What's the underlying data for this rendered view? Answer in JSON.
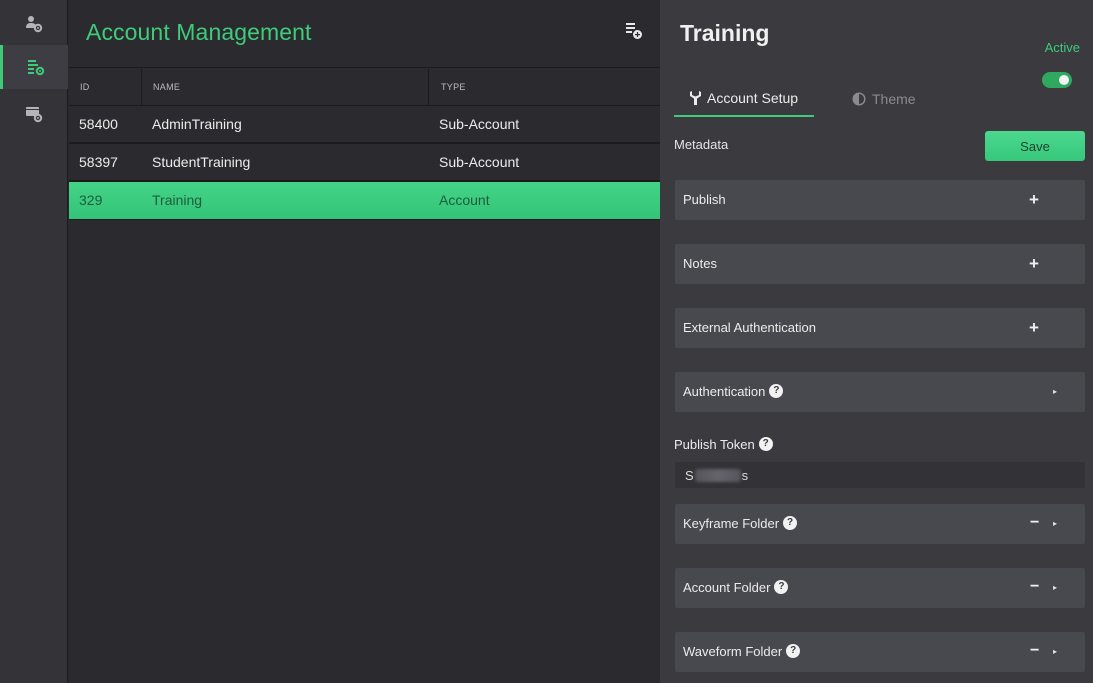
{
  "rail": {
    "items": [
      {
        "icon": "users-gear-icon",
        "active": false
      },
      {
        "icon": "list-gear-icon",
        "active": true
      },
      {
        "icon": "server-gear-icon",
        "active": false
      }
    ]
  },
  "list": {
    "title": "Account Management",
    "add_icon": "add-list-icon",
    "columns": [
      "ID",
      "NAME",
      "TYPE"
    ],
    "rows": [
      {
        "id": "58400",
        "name": "AdminTraining",
        "type": "Sub-Account",
        "selected": false
      },
      {
        "id": "58397",
        "name": "StudentTraining",
        "type": "Sub-Account",
        "selected": false
      },
      {
        "id": "329",
        "name": "Training",
        "type": "Account",
        "selected": true
      }
    ]
  },
  "detail": {
    "title": "Training",
    "status": "Active",
    "active_toggle": true,
    "tabs": [
      {
        "label": "Account Setup",
        "icon": "wrench-icon",
        "active": true
      },
      {
        "label": "Theme",
        "icon": "contrast-icon",
        "active": false
      }
    ],
    "metadata_label": "Metadata",
    "save_label": "Save",
    "sections_top": [
      {
        "label": "Publish",
        "control": "+"
      },
      {
        "label": "Notes",
        "control": "+"
      },
      {
        "label": "External Authentication",
        "control": "+"
      },
      {
        "label": "Authentication",
        "help": "?",
        "arrow": "▸"
      }
    ],
    "publish_token": {
      "label": "Publish Token",
      "help": "?",
      "value_start": "S",
      "value_end": "s"
    },
    "sections_bottom": [
      {
        "label": "Keyframe Folder",
        "help": "?",
        "minus": "−",
        "arrow": "▸"
      },
      {
        "label": "Account Folder",
        "help": "?",
        "minus": "−",
        "arrow": "▸"
      },
      {
        "label": "Waveform Folder",
        "help": "?",
        "minus": "−",
        "arrow": "▸"
      }
    ],
    "colors": {
      "accent": "#3ecb7a",
      "panel": "#3a3a3f",
      "section": "#48484f"
    }
  }
}
